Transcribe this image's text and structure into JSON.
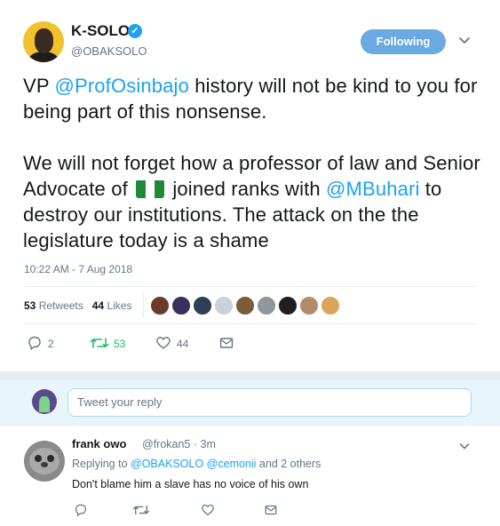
{
  "tweet": {
    "author_name": "K-SOLO",
    "author_handle": "@OBAKSOLO",
    "follow_label": "Following",
    "text": {
      "l1_pre": "VP ",
      "l1_mention": "@ProfOsinbajo",
      "l1_post": " history will not be kind to you for being part of this nonsense.",
      "l2_pre": "We will not forget how a professor of law and Senior Advocate of ",
      "l2_mid": " joined ranks with ",
      "l2_mention": "@MBuhari",
      "l2_post": " to destroy our institutions. The attack on the the legislature today is a shame"
    },
    "timestamp": "10:22 AM - 7 Aug 2018",
    "retweets_count": "53",
    "retweets_label": "Retweets",
    "likes_count": "44",
    "likes_label": "Likes",
    "liker_colors": [
      "#6b3a2a",
      "#3a2f5c",
      "#2e3e57",
      "#c9d1d9",
      "#7a5c3a",
      "#8f969d",
      "#1f1f1f",
      "#b58b6e",
      "#d9a55a"
    ],
    "actions": {
      "reply_count": "2",
      "retweet_count": "53",
      "like_count": "44"
    }
  },
  "reply_box": {
    "placeholder": "Tweet your reply"
  },
  "reply": {
    "author_name": "frank owo",
    "author_handle": "@frokan5 · 3m",
    "replying_prefix": "Replying to ",
    "replying_mention1": "@OBAKSOLO",
    "replying_mention2": "@cemonii",
    "replying_suffix": " and 2 others",
    "text": "Don't blame him a slave has no voice of his own"
  },
  "colors": {
    "accent": "#1da1f2",
    "retweet_green": "#17bf63",
    "muted": "#657786",
    "follow_button": "#6aa9e2"
  }
}
